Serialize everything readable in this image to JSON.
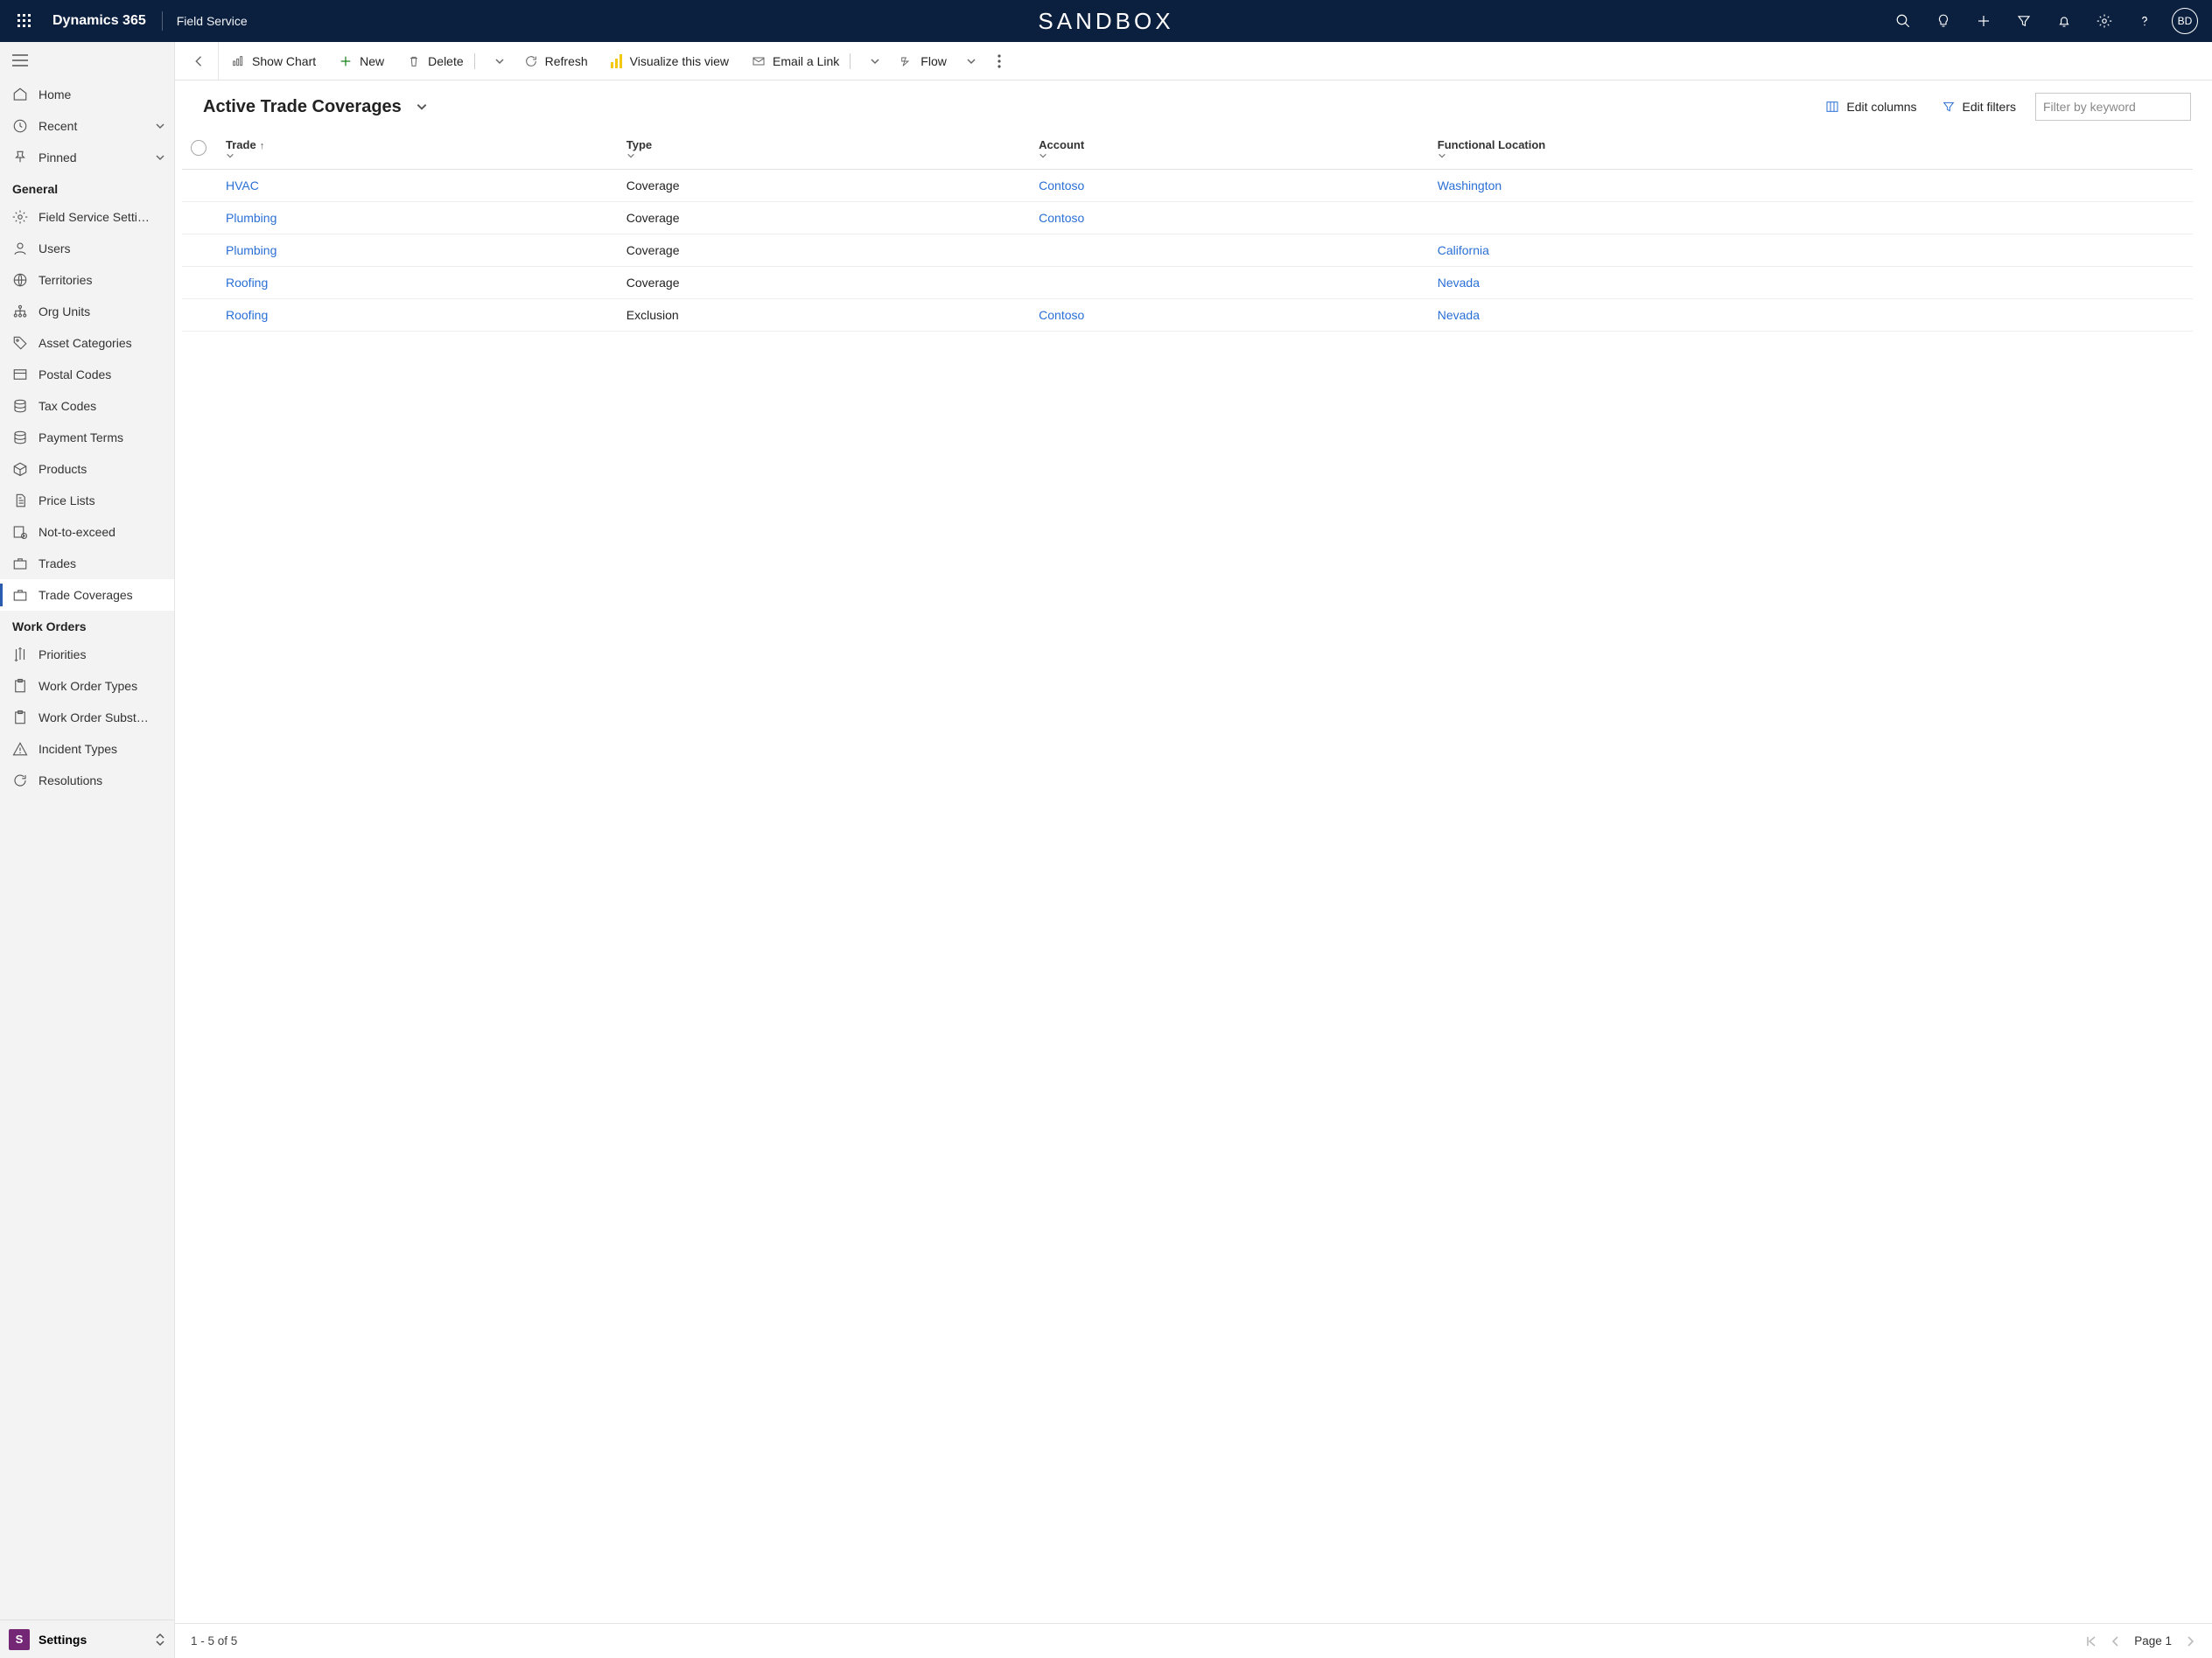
{
  "topbar": {
    "brand": "Dynamics 365",
    "module": "Field Service",
    "center": "SANDBOX",
    "avatar_initials": "BD"
  },
  "nav": {
    "top": [
      {
        "icon": "home",
        "label": "Home"
      },
      {
        "icon": "clock",
        "label": "Recent",
        "chev": true
      },
      {
        "icon": "pin",
        "label": "Pinned",
        "chev": true
      }
    ],
    "groups": [
      {
        "heading": "General",
        "items": [
          {
            "icon": "gear",
            "label": "Field Service Setti…"
          },
          {
            "icon": "person",
            "label": "Users"
          },
          {
            "icon": "globe",
            "label": "Territories"
          },
          {
            "icon": "org",
            "label": "Org Units"
          },
          {
            "icon": "tag",
            "label": "Asset Categories"
          },
          {
            "icon": "card",
            "label": "Postal Codes"
          },
          {
            "icon": "db",
            "label": "Tax Codes"
          },
          {
            "icon": "db",
            "label": "Payment Terms"
          },
          {
            "icon": "box",
            "label": "Products"
          },
          {
            "icon": "doc",
            "label": "Price Lists"
          },
          {
            "icon": "nte",
            "label": "Not-to-exceed"
          },
          {
            "icon": "briefcase",
            "label": "Trades"
          },
          {
            "icon": "briefcase",
            "label": "Trade Coverages",
            "active": true
          }
        ]
      },
      {
        "heading": "Work Orders",
        "items": [
          {
            "icon": "priorities",
            "label": "Priorities"
          },
          {
            "icon": "clip",
            "label": "Work Order Types"
          },
          {
            "icon": "clip",
            "label": "Work Order Subst…"
          },
          {
            "icon": "warn",
            "label": "Incident Types"
          },
          {
            "icon": "refresh",
            "label": "Resolutions"
          }
        ]
      }
    ],
    "footer": {
      "badge": "S",
      "label": "Settings"
    }
  },
  "commands": {
    "show_chart": "Show Chart",
    "new": "New",
    "delete": "Delete",
    "refresh": "Refresh",
    "visualize": "Visualize this view",
    "email": "Email a Link",
    "flow": "Flow"
  },
  "view": {
    "title": "Active Trade Coverages",
    "edit_columns": "Edit columns",
    "edit_filters": "Edit filters",
    "filter_placeholder": "Filter by keyword"
  },
  "grid": {
    "columns": [
      {
        "label": "Trade",
        "sorted_asc": true
      },
      {
        "label": "Type"
      },
      {
        "label": "Account"
      },
      {
        "label": "Functional Location"
      }
    ],
    "rows": [
      {
        "trade": "HVAC",
        "type": "Coverage",
        "account": "Contoso",
        "location": "Washington"
      },
      {
        "trade": "Plumbing",
        "type": "Coverage",
        "account": "Contoso",
        "location": ""
      },
      {
        "trade": "Plumbing",
        "type": "Coverage",
        "account": "",
        "location": "California"
      },
      {
        "trade": "Roofing",
        "type": "Coverage",
        "account": "",
        "location": "Nevada"
      },
      {
        "trade": "Roofing",
        "type": "Exclusion",
        "account": "Contoso",
        "location": "Nevada"
      }
    ]
  },
  "status": {
    "range": "1 - 5 of 5",
    "page_label": "Page 1"
  }
}
